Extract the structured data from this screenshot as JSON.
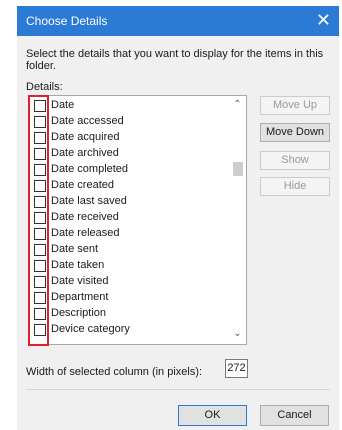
{
  "window": {
    "title": "Choose Details",
    "close_glyph": "✕"
  },
  "instruction": "Select the details that you want to display for the items in this folder.",
  "details_label": "Details:",
  "list": {
    "items": [
      {
        "label": "Date",
        "checked": false
      },
      {
        "label": "Date accessed",
        "checked": false
      },
      {
        "label": "Date acquired",
        "checked": false
      },
      {
        "label": "Date archived",
        "checked": false
      },
      {
        "label": "Date completed",
        "checked": false
      },
      {
        "label": "Date created",
        "checked": false
      },
      {
        "label": "Date last saved",
        "checked": false
      },
      {
        "label": "Date received",
        "checked": false
      },
      {
        "label": "Date released",
        "checked": false
      },
      {
        "label": "Date sent",
        "checked": false
      },
      {
        "label": "Date taken",
        "checked": false
      },
      {
        "label": "Date visited",
        "checked": false
      },
      {
        "label": "Department",
        "checked": false
      },
      {
        "label": "Description",
        "checked": false
      },
      {
        "label": "Device category",
        "checked": false
      }
    ],
    "scroll_up_glyph": "⌃",
    "scroll_down_glyph": "⌄"
  },
  "buttons": {
    "move_up": "Move Up",
    "move_down": "Move Down",
    "show": "Show",
    "hide": "Hide",
    "ok": "OK",
    "cancel": "Cancel"
  },
  "width_field": {
    "label": "Width of selected column (in pixels):",
    "value": "272"
  },
  "colors": {
    "titlebar": "#2b7ad6",
    "highlight": "#e0202a",
    "dialog_bg": "#f0f0f0"
  }
}
